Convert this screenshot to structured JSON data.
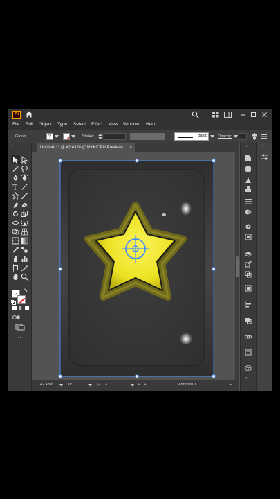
{
  "app": {
    "logo_text": "Ai",
    "icons": [
      "home-icon",
      "search-icon",
      "arrange-documents-icon",
      "workspace-icon",
      "minimize-icon",
      "restore-icon",
      "close-icon"
    ]
  },
  "menu": [
    "File",
    "Edit",
    "Object",
    "Type",
    "Select",
    "Effect",
    "View",
    "Window",
    "Help"
  ],
  "control_bar": {
    "selection_label": "Group",
    "stroke_label": "Stroke:",
    "stroke_profile": "Basic",
    "opacity_label": "Opacity:"
  },
  "document": {
    "tab_title": "Untitled-1* @ 42.43 % (CMYK/CPU Preview)",
    "close_symbol": "×"
  },
  "status": {
    "zoom": "42.43%",
    "rotation": "0°",
    "artboard_number": "1",
    "tool_name": "Artboard 1"
  },
  "colors": {
    "ui_bg": "#535353",
    "panel_bg": "#3a3a3a",
    "dark_bar": "#323232",
    "star_yellow": "#f2ea2a",
    "selection_blue": "#4a8ff2"
  },
  "left_tools": [
    "selection-tool",
    "direct-selection-tool",
    "magic-wand-tool",
    "lasso-tool",
    "pen-tool",
    "curvature-tool",
    "type-tool",
    "line-tool",
    "rectangle-tool",
    "paintbrush-tool",
    "shaper-tool",
    "pencil-tool",
    "eraser-tool",
    "rotate-tool",
    "scale-tool",
    "width-tool",
    "free-transform-tool",
    "shape-builder-tool",
    "perspective-grid-tool",
    "mesh-tool",
    "gradient-tool",
    "eyedropper-tool",
    "blend-tool",
    "symbol-sprayer-tool",
    "column-graph-tool",
    "artboard-tool",
    "slice-tool",
    "hand-tool",
    "zoom-tool"
  ],
  "right_panels": [
    "properties-icon",
    "libraries-icon",
    "color-icon",
    "swatches-icon",
    "brushes-icon",
    "symbols-icon",
    "stroke-icon",
    "gradient-icon",
    "transparency-icon",
    "appearance-icon",
    "graphic-styles-icon",
    "layers-icon",
    "asset-export-icon",
    "artboards-icon",
    "transform-icon",
    "align-icon",
    "pathfinder-icon",
    "links-icon",
    "image-trace-icon",
    "3d-icon"
  ]
}
